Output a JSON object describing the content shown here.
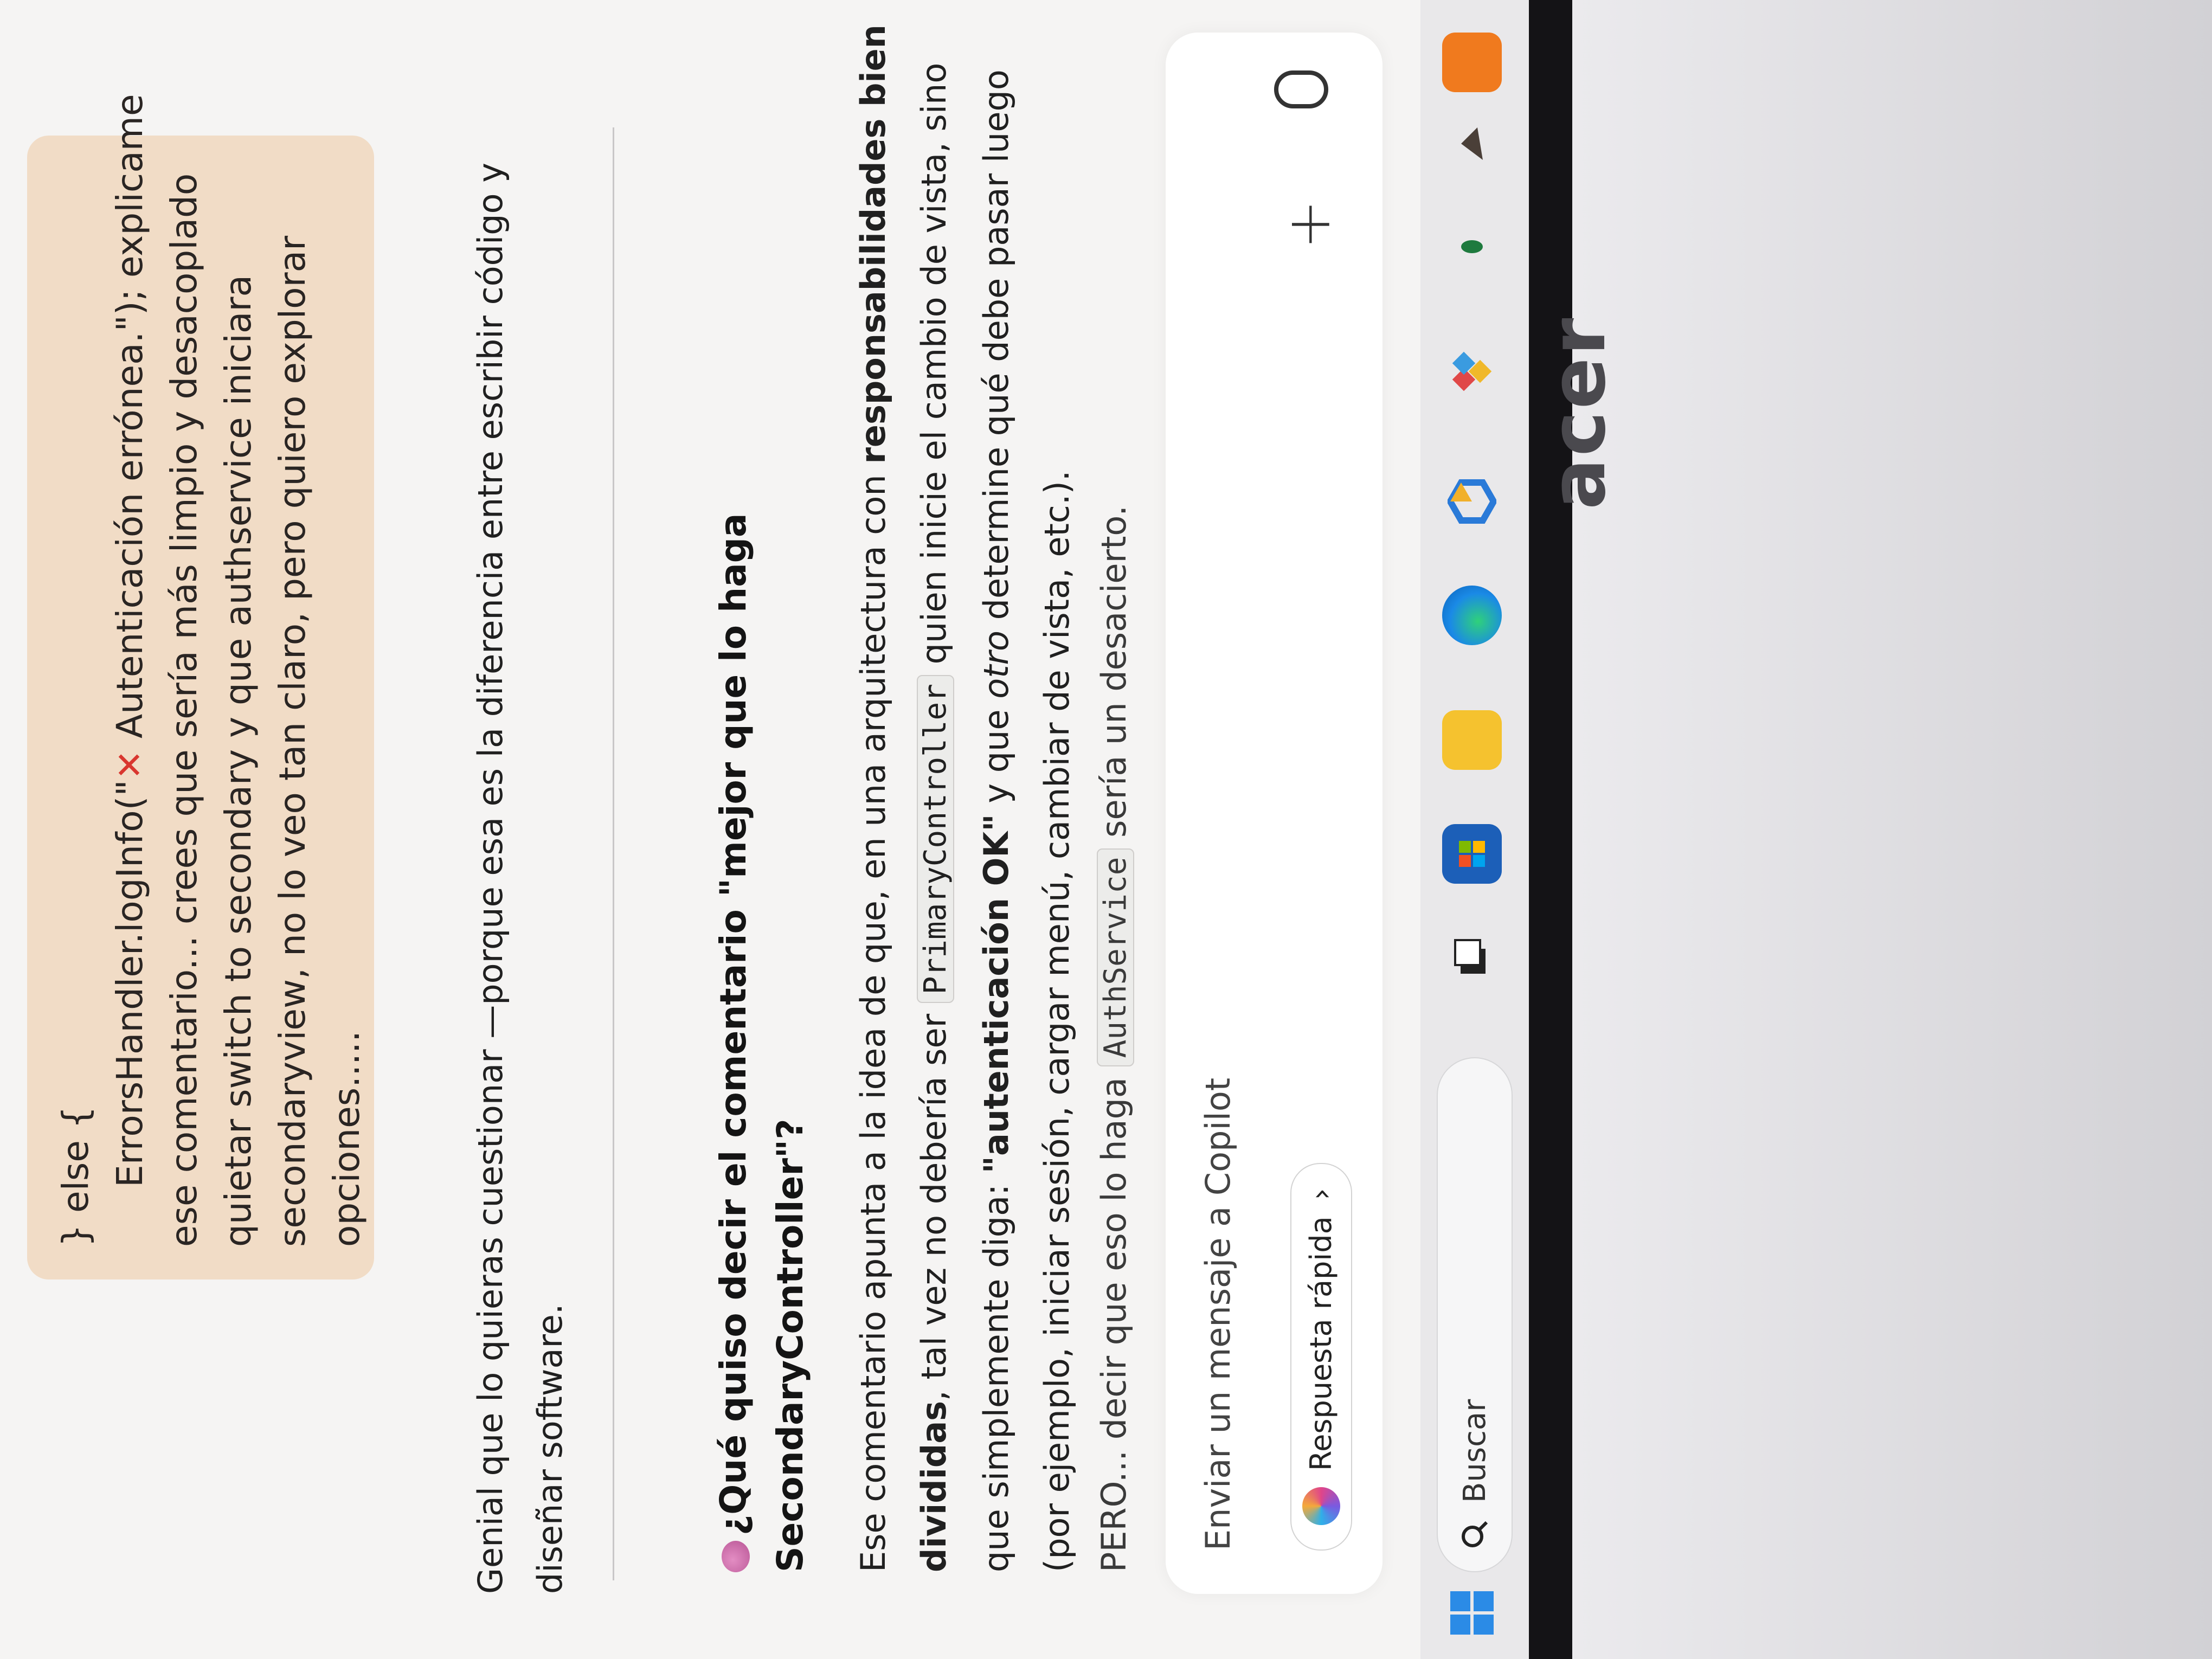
{
  "message": {
    "line1": "} else {",
    "line2_a": "ErrorsHandler.logInfo(\"",
    "line2_mark": "✕",
    "line2_b": " Autenticación errónea.\"); explicame",
    "line3": "ese comentario...    crees que sería más limpio y desacoplado",
    "line4": "quietar switch to secondary y que authservice iniciara",
    "line5": "secondaryview, no lo veo tan claro, pero quiero explorar",
    "line6": "opciones....."
  },
  "answer": {
    "intro1": "Genial que lo quieras cuestionar —porque esa es la diferencia entre escribir código y",
    "intro2": "diseñar software.",
    "heading1": "¿Qué quiso decir el comentario \"mejor que lo haga",
    "heading2": "SecondaryController\"?",
    "b1a": "Ese comentario apunta a la idea de que, en una arquitectura con ",
    "b1b": "responsabilidades bien",
    "b2a": "divididas",
    "b2b": ", tal vez no debería ser ",
    "b2code": "PrimaryController",
    "b2c": " quien inicie el cambio de vista, sino",
    "b3a": "que simplemente diga: ",
    "b3b": "\"autenticación OK\"",
    "b3c": " y que ",
    "b3d": "otro",
    "b3e": " determine qué debe pasar luego",
    "b4": "(por ejemplo, iniciar sesión, cargar menú, cambiar de vista, etc.).",
    "p1": "PERO... decir que eso lo haga ",
    "pcode": "AuthService",
    "p2": " sería un desacierto."
  },
  "composer": {
    "placeholder": "Enviar un mensaje a Copilot",
    "quick_label": "Respuesta rápida",
    "chevron": "›"
  },
  "taskbar": {
    "search_label": "Buscar"
  },
  "brand": "acer"
}
